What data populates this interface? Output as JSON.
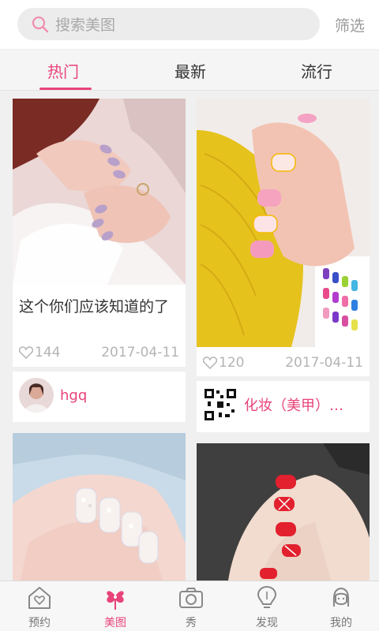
{
  "search": {
    "placeholder": "搜索美图",
    "filter_label": "筛选"
  },
  "tabs": [
    {
      "label": "热门"
    },
    {
      "label": "最新"
    },
    {
      "label": "流行"
    }
  ],
  "feed": [
    {
      "caption": "这个你们应该知道的了",
      "likes": "144",
      "date": "2017-04-11",
      "author": "hgq"
    },
    {
      "caption": "",
      "likes": "120",
      "date": "2017-04-11",
      "author": "化妆（美甲）…"
    }
  ],
  "nav": [
    {
      "label": "预约",
      "icon": "house-heart-icon"
    },
    {
      "label": "美图",
      "icon": "clover-icon"
    },
    {
      "label": "秀",
      "icon": "camera-icon"
    },
    {
      "label": "发现",
      "icon": "bulb-icon"
    },
    {
      "label": "我的",
      "icon": "person-icon"
    }
  ],
  "colors": {
    "accent": "#e8447a",
    "background": "#f0f0f0"
  }
}
